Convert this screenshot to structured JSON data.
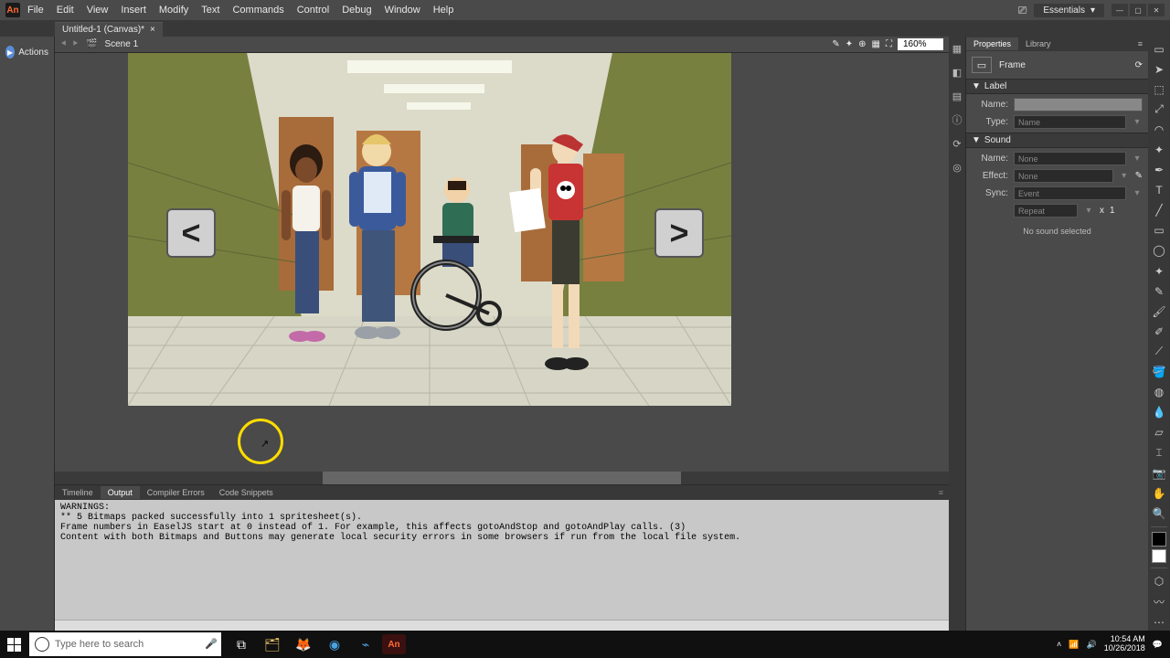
{
  "app": {
    "logo": "An"
  },
  "menu": [
    "File",
    "Edit",
    "View",
    "Insert",
    "Modify",
    "Text",
    "Commands",
    "Control",
    "Debug",
    "Window",
    "Help"
  ],
  "workspace": "Essentials",
  "docTab": {
    "title": "Untitled-1 (Canvas)*"
  },
  "actions": {
    "label": "Actions"
  },
  "sceneBar": {
    "scene": "Scene 1",
    "zoom": "160%"
  },
  "navButtons": {
    "prev": "<",
    "next": ">"
  },
  "bottomTabs": [
    "Timeline",
    "Output",
    "Compiler Errors",
    "Code Snippets"
  ],
  "bottomActive": 1,
  "output": "WARNINGS:\n** 5 Bitmaps packed successfully into 1 spritesheet(s).\nFrame numbers in EaselJS start at 0 instead of 1. For example, this affects gotoAndStop and gotoAndPlay calls. (3)\nContent with both Bitmaps and Buttons may generate local security errors in some browsers if run from the local file system.",
  "propsTabs": [
    "Properties",
    "Library"
  ],
  "propsHeader": "Frame",
  "labelSection": {
    "title": "Label",
    "name_label": "Name:",
    "name_value": "",
    "type_label": "Type:",
    "type_value": "Name"
  },
  "soundSection": {
    "title": "Sound",
    "name_label": "Name:",
    "name_value": "None",
    "effect_label": "Effect:",
    "effect_value": "None",
    "sync_label": "Sync:",
    "sync_value": "Event",
    "repeat_value": "Repeat",
    "repeat_x": "x",
    "repeat_n": "1",
    "nosound": "No sound selected"
  },
  "taskbar": {
    "search_placeholder": "Type here to search",
    "time": "10:54 AM",
    "date": "10/26/2018"
  }
}
